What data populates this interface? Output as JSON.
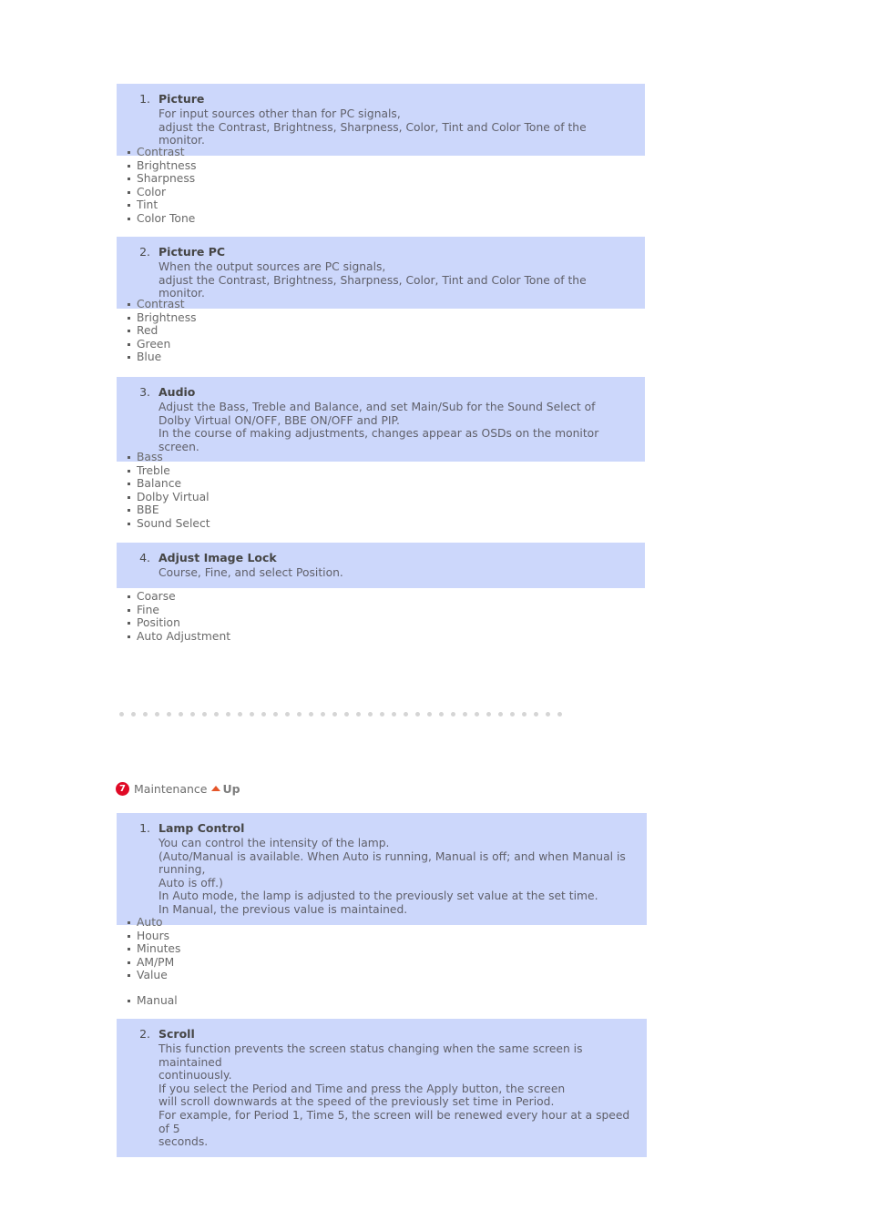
{
  "colors": {
    "panel_bg": "#ccd7fb",
    "badge_red": "#e00a26",
    "arrow_orange": "#e5562a",
    "dot_gray": "#d5d5d5",
    "text_gray": "#6a6a6a"
  },
  "blocks": {
    "picture": {
      "number": "1.",
      "title": "Picture",
      "lines": [
        "For input sources other than for PC signals,",
        "adjust the Contrast, Brightness, Sharpness, Color, Tint and Color Tone of the monitor."
      ],
      "items": [
        "Contrast",
        "Brightness",
        "Sharpness",
        "Color",
        "Tint",
        "Color Tone"
      ]
    },
    "picture_pc": {
      "number": "2.",
      "title": "Picture PC",
      "lines": [
        "When the output sources are PC signals,",
        "adjust the Contrast, Brightness, Sharpness, Color, Tint and Color Tone of the monitor."
      ],
      "items": [
        "Contrast",
        "Brightness",
        "Red",
        "Green",
        "Blue"
      ]
    },
    "audio": {
      "number": "3.",
      "title": "Audio",
      "lines": [
        "Adjust the Bass, Treble and Balance, and set Main/Sub for the Sound Select of",
        "Dolby Virtual ON/OFF, BBE ON/OFF and PIP.",
        "In the course of making adjustments, changes appear as OSDs on the monitor screen."
      ],
      "items": [
        "Bass",
        "Treble",
        "Balance",
        "Dolby Virtual",
        "BBE",
        "Sound Select"
      ]
    },
    "image_lock": {
      "number": "4.",
      "title": "Adjust Image Lock",
      "lines": [
        "Course, Fine, and select Position."
      ],
      "items": [
        "Coarse",
        "Fine",
        "Position",
        "Auto Adjustment"
      ]
    },
    "lamp_control": {
      "number": "1.",
      "title": "Lamp Control",
      "lines": [
        "You can control the intensity of the lamp.",
        "(Auto/Manual is available. When Auto is running, Manual is off; and when Manual is running,\nAuto is off.)",
        "In Auto mode, the lamp is adjusted to the previously set value at the set time.",
        "In Manual, the previous value is maintained."
      ],
      "items": [
        "Auto",
        "Hours",
        "Minutes",
        "AM/PM",
        "Value"
      ],
      "items2": [
        "Manual"
      ]
    },
    "scroll": {
      "number": "2.",
      "title": "Scroll",
      "lines": [
        "This function prevents the screen status changing when the same screen is maintained\ncontinuously.",
        "If you select the Period and Time and press the Apply button, the screen",
        "will scroll downwards at the speed of the previously set time in Period.",
        "For example, for Period 1, Time 5, the screen will be renewed every hour at a speed of 5\nseconds."
      ]
    }
  },
  "maintenance_heading": {
    "badge": "7",
    "title": "Maintenance",
    "up_label": "Up"
  },
  "divider": {
    "dot_count": 38
  }
}
